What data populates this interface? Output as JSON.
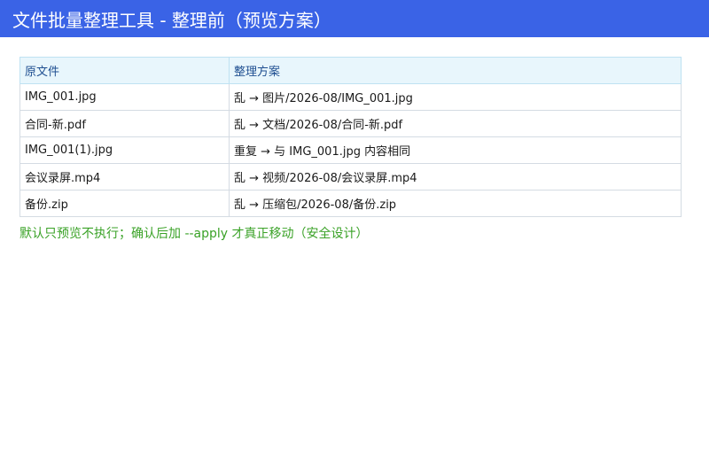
{
  "window": {
    "title": "文件批量整理工具 - 整理前（预览方案）"
  },
  "table": {
    "headers": [
      "原文件",
      "整理方案"
    ],
    "rows": [
      [
        "IMG_001.jpg",
        "乱 → 图片/2026-08/IMG_001.jpg"
      ],
      [
        "合同-新.pdf",
        "乱 → 文档/2026-08/合同-新.pdf"
      ],
      [
        "IMG_001(1).jpg",
        "重复 → 与 IMG_001.jpg 内容相同"
      ],
      [
        "会议录屏.mp4",
        "乱 → 视频/2026-08/会议录屏.mp4"
      ],
      [
        "备份.zip",
        "乱 → 压缩包/2026-08/备份.zip"
      ]
    ]
  },
  "footer": {
    "note": "默认只预览不执行；确认后加 --apply 才真正移动（安全设计）"
  },
  "colors": {
    "title_bar": "#3a63e6",
    "header_bg": "#e8f6fc",
    "note_text": "#3aa227"
  }
}
